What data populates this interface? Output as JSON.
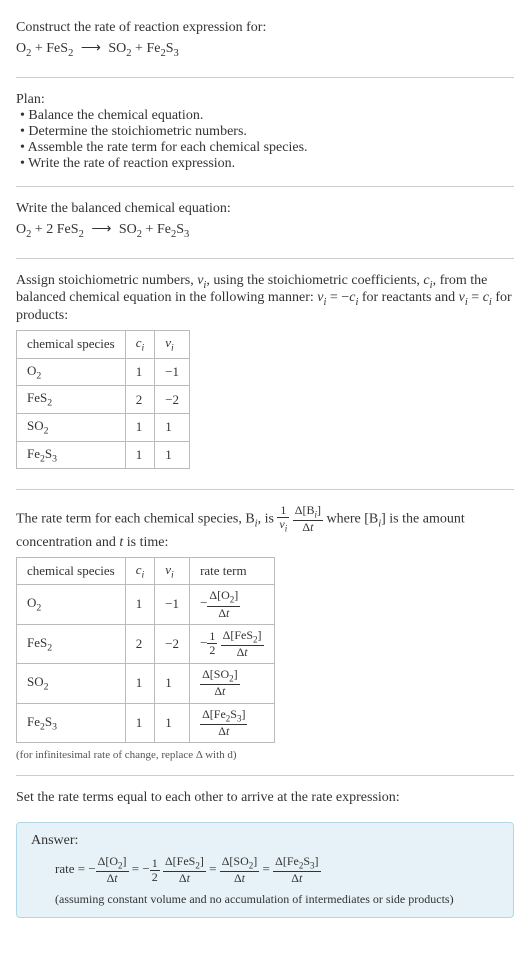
{
  "intro": {
    "construct": "Construct the rate of reaction expression for:",
    "eq_unbalanced_html": "O<sub>2</sub> + FeS<sub>2</sub> <span class='arrow'>⟶</span> SO<sub>2</sub> + Fe<sub>2</sub>S<sub>3</sub>"
  },
  "plan": {
    "title": "Plan:",
    "items": [
      "Balance the chemical equation.",
      "Determine the stoichiometric numbers.",
      "Assemble the rate term for each chemical species.",
      "Write the rate of reaction expression."
    ]
  },
  "balanced": {
    "title": "Write the balanced chemical equation:",
    "eq_html": "O<sub>2</sub> + 2 FeS<sub>2</sub> <span class='arrow'>⟶</span> SO<sub>2</sub> + Fe<sub>2</sub>S<sub>3</sub>"
  },
  "stoich": {
    "intro_html": "Assign stoichiometric numbers, <i>ν<sub>i</sub></i>, using the stoichiometric coefficients, <i>c<sub>i</sub></i>, from the balanced chemical equation in the following manner: <i>ν<sub>i</sub></i> = −<i>c<sub>i</sub></i> for reactants and <i>ν<sub>i</sub></i> = <i>c<sub>i</sub></i> for products:",
    "headers": {
      "species": "chemical species",
      "ci": "cᵢ",
      "vi": "νᵢ"
    },
    "rows": [
      {
        "species_html": "O<sub>2</sub>",
        "ci": "1",
        "vi": "−1"
      },
      {
        "species_html": "FeS<sub>2</sub>",
        "ci": "2",
        "vi": "−2"
      },
      {
        "species_html": "SO<sub>2</sub>",
        "ci": "1",
        "vi": "1"
      },
      {
        "species_html": "Fe<sub>2</sub>S<sub>3</sub>",
        "ci": "1",
        "vi": "1"
      }
    ]
  },
  "rateterm": {
    "intro_html": "The rate term for each chemical species, B<sub><i>i</i></sub>, is <span class='nowrap'><span class='frac'><span class='num'>1</span><span class='den'><i>ν<sub>i</sub></i></span></span> <span class='frac'><span class='num'>Δ[B<sub><i>i</i></sub>]</span><span class='den'>Δ<i>t</i></span></span></span> where [B<sub><i>i</i></sub>] is the amount concentration and <i>t</i> is time:",
    "headers": {
      "species": "chemical species",
      "ci": "cᵢ",
      "vi": "νᵢ",
      "rate": "rate term"
    },
    "rows": [
      {
        "species_html": "O<sub>2</sub>",
        "ci": "1",
        "vi": "−1",
        "rate_html": "−<span class='frac'><span class='num'>Δ[O<sub>2</sub>]</span><span class='den'>Δ<i>t</i></span></span>"
      },
      {
        "species_html": "FeS<sub>2</sub>",
        "ci": "2",
        "vi": "−2",
        "rate_html": "−<span class='frac'><span class='num'>1</span><span class='den'>2</span></span> <span class='frac'><span class='num'>Δ[FeS<sub>2</sub>]</span><span class='den'>Δ<i>t</i></span></span>"
      },
      {
        "species_html": "SO<sub>2</sub>",
        "ci": "1",
        "vi": "1",
        "rate_html": "<span class='frac'><span class='num'>Δ[SO<sub>2</sub>]</span><span class='den'>Δ<i>t</i></span></span>"
      },
      {
        "species_html": "Fe<sub>2</sub>S<sub>3</sub>",
        "ci": "1",
        "vi": "1",
        "rate_html": "<span class='frac'><span class='num'>Δ[Fe<sub>2</sub>S<sub>3</sub>]</span><span class='den'>Δ<i>t</i></span></span>"
      }
    ],
    "note": "(for infinitesimal rate of change, replace Δ with d)"
  },
  "final": {
    "title": "Set the rate terms equal to each other to arrive at the rate expression:"
  },
  "answer": {
    "label": "Answer:",
    "rate_html": "rate = −<span class='frac'><span class='num'>Δ[O<sub>2</sub>]</span><span class='den'>Δ<i>t</i></span></span> = −<span class='frac'><span class='num'>1</span><span class='den'>2</span></span> <span class='frac'><span class='num'>Δ[FeS<sub>2</sub>]</span><span class='den'>Δ<i>t</i></span></span> = <span class='frac'><span class='num'>Δ[SO<sub>2</sub>]</span><span class='den'>Δ<i>t</i></span></span> = <span class='frac'><span class='num'>Δ[Fe<sub>2</sub>S<sub>3</sub>]</span><span class='den'>Δ<i>t</i></span></span>",
    "assume": "(assuming constant volume and no accumulation of intermediates or side products)"
  }
}
